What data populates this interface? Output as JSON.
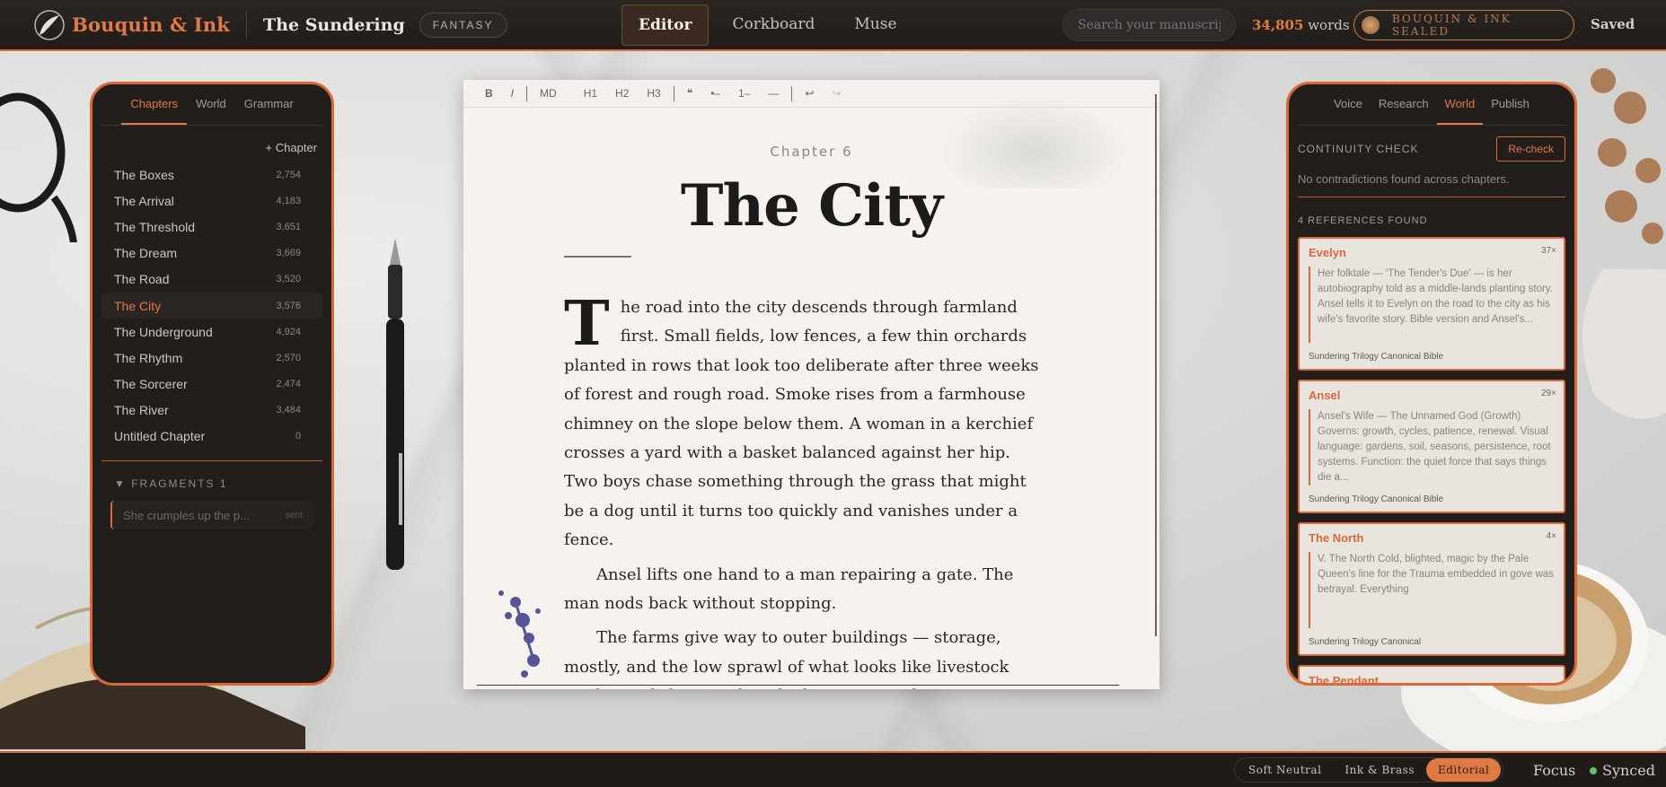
{
  "header": {
    "brand": "Bouquin & Ink",
    "doc_title": "The Sundering",
    "genre": "FANTASY",
    "modes": [
      "Editor",
      "Corkboard",
      "Muse"
    ],
    "search_placeholder": "Search your manuscript",
    "word_count": "34,805",
    "word_label": "words",
    "seal": "BOUQUIN & INK SEALED",
    "save_status": "Saved"
  },
  "left_panel": {
    "tabs": [
      "Chapters",
      "World",
      "Grammar"
    ],
    "add_chapter": "+ Chapter",
    "chapters": [
      {
        "name": "The Boxes",
        "words": "2,754"
      },
      {
        "name": "The Arrival",
        "words": "4,183"
      },
      {
        "name": "The Threshold",
        "words": "3,651"
      },
      {
        "name": "The Dream",
        "words": "3,669"
      },
      {
        "name": "The Road",
        "words": "3,520"
      },
      {
        "name": "The City",
        "words": "3,576"
      },
      {
        "name": "The Underground",
        "words": "4,924"
      },
      {
        "name": "The Rhythm",
        "words": "2,570"
      },
      {
        "name": "The Sorcerer",
        "words": "2,474"
      },
      {
        "name": "The River",
        "words": "3,484"
      },
      {
        "name": "Untitled Chapter",
        "words": "0"
      }
    ],
    "fragments_label": "▼  FRAGMENTS  1",
    "fragment": {
      "text": "She crumples up the p...",
      "status": "sent"
    }
  },
  "editor": {
    "toolbar": [
      "B",
      "I",
      "MD",
      "H1",
      "H2",
      "H3",
      "❝",
      "•–",
      "1–",
      "—",
      "↩",
      "↪"
    ],
    "chapter_label": "Chapter 6",
    "chapter_title": "The City",
    "dropcap": "T",
    "para1_rest": "he road into the city descends through farmland first. Small fields, low fences, a few thin orchards planted in rows that look too deliberate after three weeks of forest and rough road. Smoke rises from a farmhouse chimney on the slope below them. A woman in a kerchief crosses a yard with a basket balanced against her hip. Two boys chase something through the grass that might be a dog until it turns too quickly and vanishes under a fence.",
    "para2": "Ansel lifts one hand to a man repairing a gate. The man nods back without stopping.",
    "para3": "The farms give way to outer buildings — storage, mostly, and the low sprawl of what looks like livestock yards, workshops with wide doors propped open against the afternoon heat."
  },
  "right_panel": {
    "tabs": [
      "Voice",
      "Research",
      "World",
      "Publish"
    ],
    "continuity_title": "CONTINUITY CHECK",
    "recheck": "Re-check",
    "continuity_note": "No contradictions found across chapters.",
    "refs_head": "4 REFERENCES FOUND",
    "references": [
      {
        "name": "Evelyn",
        "count": "37×",
        "body": "Her folktale — 'The Tender's Due' — is her autobiography told as a middle-lands planting story. Ansel tells it to Evelyn on the road to the city as his wife's favorite story. Bible version and Ansel's...",
        "source": "Sundering Trilogy Canonical Bible"
      },
      {
        "name": "Ansel",
        "count": "29×",
        "body": "Ansel's Wife — The Unnamed God (Growth) Governs: growth, cycles, patience, renewal. Visual language: gardens, soil, seasons, persistence, root systems. Function: the quiet force that says things die a...",
        "source": "Sundering Trilogy Canonical Bible"
      },
      {
        "name": "The North",
        "count": "4×",
        "body": "V. The North Cold, blighted, magic by the Pale Queen's line for the Trauma embedded in gove was betrayal. Everything",
        "source": "Sundering Trilogy Canonical"
      },
      {
        "name": "The Pendant",
        "count": "",
        "body": "",
        "source": ""
      }
    ]
  },
  "footer": {
    "themes": [
      "Soft Neutral",
      "Ink & Brass",
      "Editorial"
    ],
    "active_theme": "Editorial",
    "focus": "Focus",
    "sync": "Synced"
  },
  "colors": {
    "accent": "#d9683a",
    "panel": "#211e1c",
    "paper": "#f6f3ee"
  }
}
